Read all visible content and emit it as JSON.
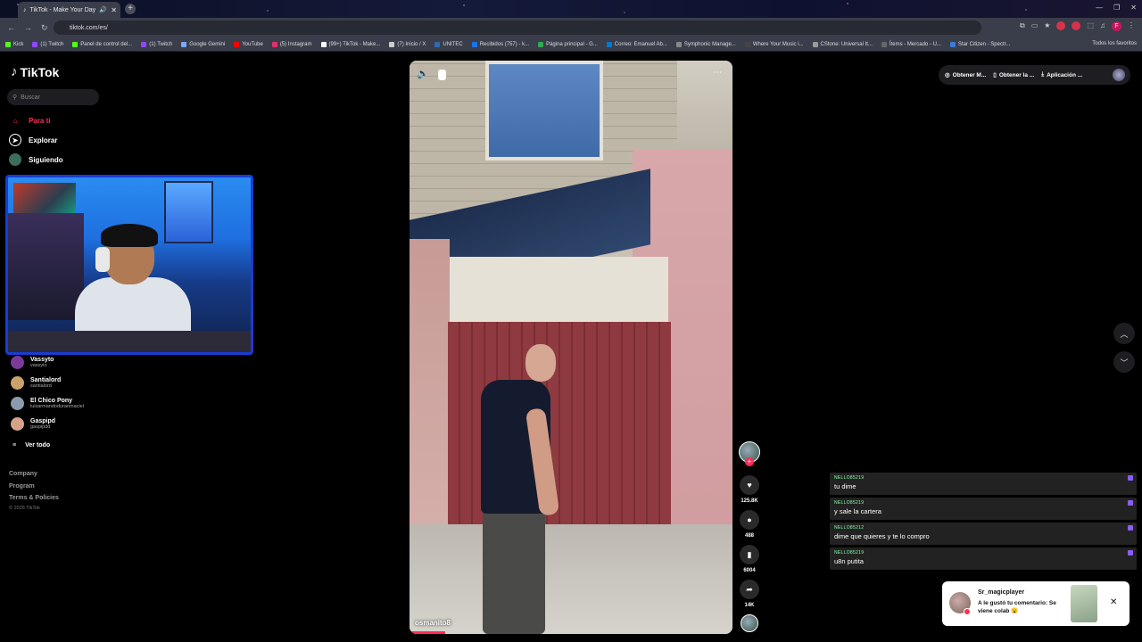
{
  "browser": {
    "tab_title": "TikTok - Make Your Day",
    "url": "tiktok.com/es/",
    "bookmarks": [
      {
        "label": "Kick",
        "color": "#53fc18"
      },
      {
        "label": "(1) Twitch",
        "color": "#9146ff"
      },
      {
        "label": "Panel de control del...",
        "color": "#53fc18"
      },
      {
        "label": "(1) Twitch",
        "color": "#9146ff"
      },
      {
        "label": "Google Gemini",
        "color": "#7aa7ff"
      },
      {
        "label": "YouTube",
        "color": "#ff0000"
      },
      {
        "label": "(5) Instagram",
        "color": "#e1306c"
      },
      {
        "label": "(99+) TikTok - Make...",
        "color": "#ffffff"
      },
      {
        "label": "(7) Inicio / X",
        "color": "#cccccc"
      },
      {
        "label": "UNITEC",
        "color": "#2b6cb0"
      },
      {
        "label": "Recibidos (757) - k...",
        "color": "#1a73e8"
      },
      {
        "label": "Página principal - G...",
        "color": "#34a853"
      },
      {
        "label": "Correo: Emanuel Ab...",
        "color": "#0078d4"
      },
      {
        "label": "Symphonic Manage...",
        "color": "#888888"
      },
      {
        "label": "Where Your Music i...",
        "color": "#444444"
      },
      {
        "label": "CStone: Universal It...",
        "color": "#999999"
      },
      {
        "label": "Ítems - Mercado - U...",
        "color": "#666666"
      },
      {
        "label": "Star Citizen - Spectr...",
        "color": "#3a7bd5"
      }
    ],
    "all_bookmarks": "Todos los favoritos"
  },
  "sidebar": {
    "logo": "TikTok",
    "search_placeholder": "Buscar",
    "nav": {
      "for_you": "Para ti",
      "explore": "Explorar",
      "following": "Siguiendo"
    },
    "followed": [
      {
        "name": "Vassyto",
        "handle": "vassyto",
        "color": "#7a3a9a"
      },
      {
        "name": "Santialord",
        "handle": "santialord",
        "color": "#c9a36a"
      },
      {
        "name": "El Chico Pony",
        "handle": "luisarmandoduranmaciel",
        "color": "#8a9bb0"
      },
      {
        "name": "Gaspipd",
        "handle": "gaspipdd",
        "color": "#d4a38a"
      }
    ],
    "see_all": "Ver todo",
    "footer": {
      "company": "Company",
      "program": "Program",
      "terms": "Terms & Policies",
      "copyright": "© 2026 TikTok"
    }
  },
  "video": {
    "author": "osmanito8",
    "progress_fraction": 0.11
  },
  "actions": {
    "likes": "125.8K",
    "comments": "488",
    "saves": "6004",
    "shares": "14K"
  },
  "topbar": {
    "get_coins": "Obtener M...",
    "get_app": "Obtener la ...",
    "desktop_app": "Aplicación ..."
  },
  "chat": [
    {
      "user": "NELLO85219",
      "text": "tu dime"
    },
    {
      "user": "NELLO85219",
      "text": "y sale la cartera"
    },
    {
      "user": "NELLO85212",
      "text": "dime que quieres y te lo compro"
    },
    {
      "user": "NELLO85219",
      "text": "u8n putita"
    }
  ],
  "notification": {
    "name": "Sr_magicplayer",
    "text": "A le gustó tu comentario: Se viene colab 😮"
  }
}
